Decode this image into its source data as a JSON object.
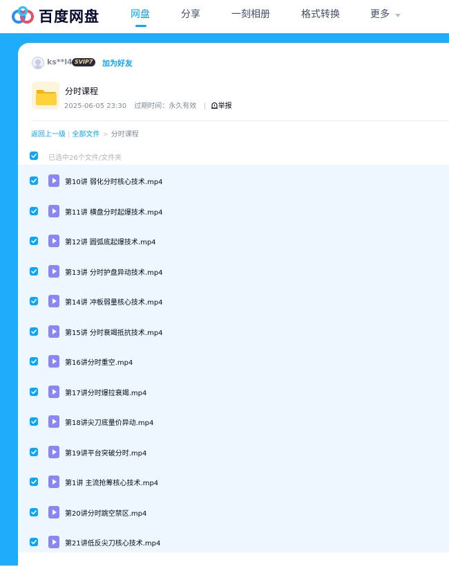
{
  "brand": {
    "name": "百度网盘"
  },
  "nav": [
    {
      "label": "网盘",
      "active": true
    },
    {
      "label": "分享",
      "active": false
    },
    {
      "label": "一刻相册",
      "active": false
    },
    {
      "label": "格式转换",
      "active": false
    },
    {
      "label": "更多",
      "active": false,
      "has_dropdown": true
    }
  ],
  "sharer": {
    "name": "ks**l4",
    "badge": "SVIP7",
    "add_friend": "加为好友"
  },
  "share": {
    "icon": "folder-icon",
    "title": "分时课程",
    "date": "2025-06-05 23:30",
    "expiry_label": "过期时间：",
    "expiry_value": "永久有效",
    "report_label": "举报"
  },
  "breadcrumb": {
    "back": "返回上一级",
    "all": "全部文件",
    "current": "分时课程"
  },
  "selection": {
    "checked": true,
    "text": "已选中26个文件/文件夹"
  },
  "files": [
    {
      "name": "第10讲 弱化分时核心技术.mp4",
      "checked": true
    },
    {
      "name": "第11讲 横盘分时起爆技术.mp4",
      "checked": true
    },
    {
      "name": "第12讲 圆弧底起爆技术.mp4",
      "checked": true
    },
    {
      "name": "第13讲 分时护盘异动技术.mp4",
      "checked": true
    },
    {
      "name": "第14讲 冲板弱量核心技术.mp4",
      "checked": true
    },
    {
      "name": "第15讲 分时衰竭抵抗技术.mp4",
      "checked": true
    },
    {
      "name": "第16讲分时重空.mp4",
      "checked": true
    },
    {
      "name": "第17讲分时爆拉衰竭.mp4",
      "checked": true
    },
    {
      "name": "第18讲尖刀底量价异动.mp4",
      "checked": true
    },
    {
      "name": "第19讲平台突破分时.mp4",
      "checked": true
    },
    {
      "name": "第1讲 主流抢筹核心技术.mp4",
      "checked": true
    },
    {
      "name": "第20讲分时跳空禁区.mp4",
      "checked": true
    },
    {
      "name": "第21讲低反尖刀核心技术.mp4",
      "checked": true
    }
  ],
  "colors": {
    "accent": "#06a7ff",
    "band": "#1eacfb",
    "list_bg": "#eef7ff",
    "video_icon": "#8a87f2"
  }
}
